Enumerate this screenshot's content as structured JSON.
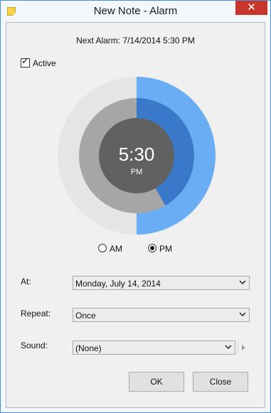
{
  "window": {
    "title": "New Note - Alarm",
    "close_glyph": "✕"
  },
  "next_alarm": "Next Alarm: 7/14/2014 5:30 PM",
  "active": {
    "label": "Active",
    "checked": true
  },
  "dial": {
    "time": "5:30",
    "period": "PM",
    "hour_fraction": 0.4167,
    "minute_fraction": 0.5,
    "colors": {
      "outer_track": "#e5e5e5",
      "outer_fill": "#69adf5",
      "inner_track": "#a6a6a6",
      "inner_fill": "#3a78c9",
      "center": "#616161"
    }
  },
  "period_options": [
    {
      "label": "AM",
      "selected": false
    },
    {
      "label": "PM",
      "selected": true
    }
  ],
  "fields": {
    "at": {
      "label": "At:",
      "value": "Monday, July 14, 2014"
    },
    "repeat": {
      "label": "Repeat:",
      "value": "Once"
    },
    "sound": {
      "label": "Sound:",
      "value": "(None)"
    }
  },
  "buttons": {
    "ok": "OK",
    "close": "Close"
  },
  "icons": {
    "app": "sticky-note-icon",
    "dropdown": "chevron-down-icon",
    "play": "play-icon"
  }
}
